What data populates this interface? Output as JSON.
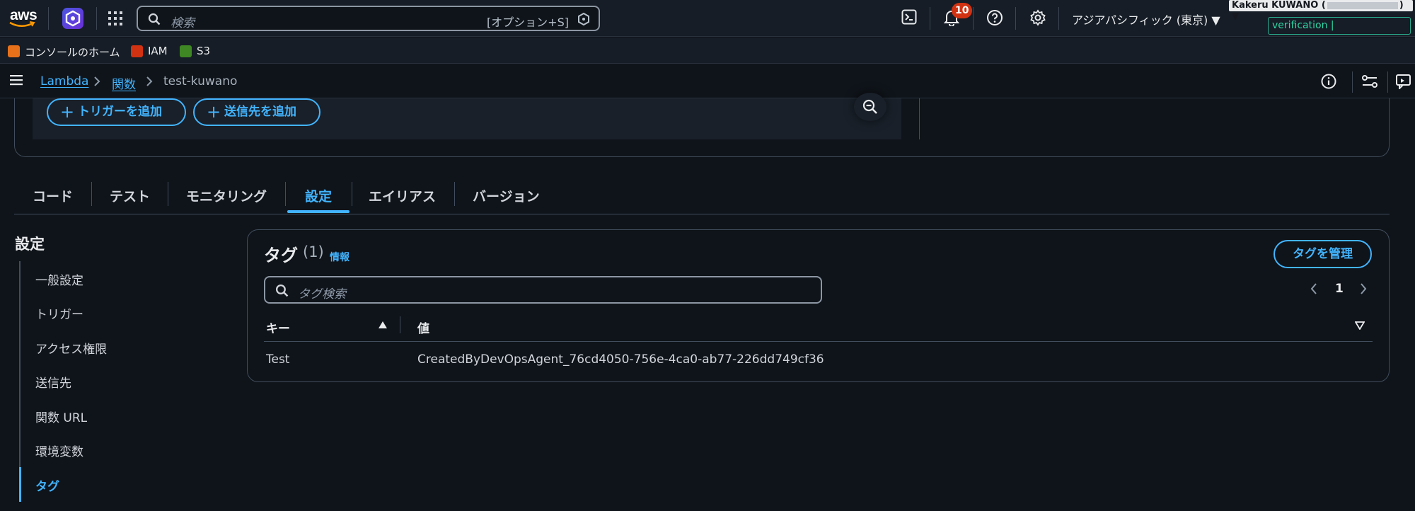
{
  "topnav": {
    "logo_text": "aws",
    "search_placeholder": "検索",
    "search_shortcut": "[オプション+S]",
    "notifications_count": "10",
    "region": "アジアパシフィック (東京) ▼",
    "user_prefix": "Kakeru KUWANO (",
    "user_suffix": ") ▼",
    "account_label": "verification |"
  },
  "favorites": [
    {
      "label": "コンソールのホーム",
      "color": "#e7711b"
    },
    {
      "label": "IAM",
      "color": "#d13212"
    },
    {
      "label": "S3",
      "color": "#3f8624"
    }
  ],
  "breadcrumb": {
    "items": [
      "Lambda",
      "関数"
    ],
    "current": "test-kuwano"
  },
  "diagram": {
    "add_trigger": "トリガーを追加",
    "add_destination": "送信先を追加"
  },
  "tabs": [
    {
      "label": "コード"
    },
    {
      "label": "テスト"
    },
    {
      "label": "モニタリング"
    },
    {
      "label": "設定",
      "active": true
    },
    {
      "label": "エイリアス"
    },
    {
      "label": "バージョン"
    }
  ],
  "sidenav": {
    "title": "設定",
    "items": [
      {
        "label": "一般設定"
      },
      {
        "label": "トリガー"
      },
      {
        "label": "アクセス権限"
      },
      {
        "label": "送信先"
      },
      {
        "label": "関数 URL"
      },
      {
        "label": "環境変数"
      },
      {
        "label": "タグ",
        "active": true
      }
    ]
  },
  "tags": {
    "title": "タグ",
    "count": "(1)",
    "info": "情報",
    "manage_button": "タグを管理",
    "search_placeholder": "タグ検索",
    "page": "1",
    "columns": [
      "キー",
      "値"
    ],
    "rows": [
      {
        "key": "Test",
        "value": "CreatedByDevOpsAgent_76cd4050-756e-4ca0-ab77-226dd749cf36"
      }
    ]
  },
  "colors": {
    "accent": "#42b4ff",
    "background": "#0f141a",
    "header": "#161d26",
    "badge": "#d13212"
  }
}
